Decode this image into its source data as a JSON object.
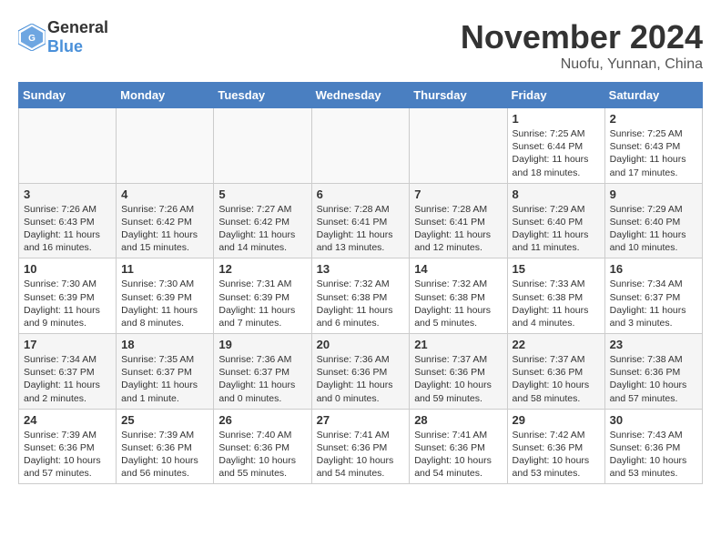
{
  "logo": {
    "text_general": "General",
    "text_blue": "Blue"
  },
  "header": {
    "month_title": "November 2024",
    "subtitle": "Nuofu, Yunnan, China"
  },
  "calendar": {
    "days_of_week": [
      "Sunday",
      "Monday",
      "Tuesday",
      "Wednesday",
      "Thursday",
      "Friday",
      "Saturday"
    ],
    "weeks": [
      [
        {
          "day": "",
          "info": ""
        },
        {
          "day": "",
          "info": ""
        },
        {
          "day": "",
          "info": ""
        },
        {
          "day": "",
          "info": ""
        },
        {
          "day": "",
          "info": ""
        },
        {
          "day": "1",
          "info": "Sunrise: 7:25 AM\nSunset: 6:44 PM\nDaylight: 11 hours and 18 minutes."
        },
        {
          "day": "2",
          "info": "Sunrise: 7:25 AM\nSunset: 6:43 PM\nDaylight: 11 hours and 17 minutes."
        }
      ],
      [
        {
          "day": "3",
          "info": "Sunrise: 7:26 AM\nSunset: 6:43 PM\nDaylight: 11 hours and 16 minutes."
        },
        {
          "day": "4",
          "info": "Sunrise: 7:26 AM\nSunset: 6:42 PM\nDaylight: 11 hours and 15 minutes."
        },
        {
          "day": "5",
          "info": "Sunrise: 7:27 AM\nSunset: 6:42 PM\nDaylight: 11 hours and 14 minutes."
        },
        {
          "day": "6",
          "info": "Sunrise: 7:28 AM\nSunset: 6:41 PM\nDaylight: 11 hours and 13 minutes."
        },
        {
          "day": "7",
          "info": "Sunrise: 7:28 AM\nSunset: 6:41 PM\nDaylight: 11 hours and 12 minutes."
        },
        {
          "day": "8",
          "info": "Sunrise: 7:29 AM\nSunset: 6:40 PM\nDaylight: 11 hours and 11 minutes."
        },
        {
          "day": "9",
          "info": "Sunrise: 7:29 AM\nSunset: 6:40 PM\nDaylight: 11 hours and 10 minutes."
        }
      ],
      [
        {
          "day": "10",
          "info": "Sunrise: 7:30 AM\nSunset: 6:39 PM\nDaylight: 11 hours and 9 minutes."
        },
        {
          "day": "11",
          "info": "Sunrise: 7:30 AM\nSunset: 6:39 PM\nDaylight: 11 hours and 8 minutes."
        },
        {
          "day": "12",
          "info": "Sunrise: 7:31 AM\nSunset: 6:39 PM\nDaylight: 11 hours and 7 minutes."
        },
        {
          "day": "13",
          "info": "Sunrise: 7:32 AM\nSunset: 6:38 PM\nDaylight: 11 hours and 6 minutes."
        },
        {
          "day": "14",
          "info": "Sunrise: 7:32 AM\nSunset: 6:38 PM\nDaylight: 11 hours and 5 minutes."
        },
        {
          "day": "15",
          "info": "Sunrise: 7:33 AM\nSunset: 6:38 PM\nDaylight: 11 hours and 4 minutes."
        },
        {
          "day": "16",
          "info": "Sunrise: 7:34 AM\nSunset: 6:37 PM\nDaylight: 11 hours and 3 minutes."
        }
      ],
      [
        {
          "day": "17",
          "info": "Sunrise: 7:34 AM\nSunset: 6:37 PM\nDaylight: 11 hours and 2 minutes."
        },
        {
          "day": "18",
          "info": "Sunrise: 7:35 AM\nSunset: 6:37 PM\nDaylight: 11 hours and 1 minute."
        },
        {
          "day": "19",
          "info": "Sunrise: 7:36 AM\nSunset: 6:37 PM\nDaylight: 11 hours and 0 minutes."
        },
        {
          "day": "20",
          "info": "Sunrise: 7:36 AM\nSunset: 6:36 PM\nDaylight: 11 hours and 0 minutes."
        },
        {
          "day": "21",
          "info": "Sunrise: 7:37 AM\nSunset: 6:36 PM\nDaylight: 10 hours and 59 minutes."
        },
        {
          "day": "22",
          "info": "Sunrise: 7:37 AM\nSunset: 6:36 PM\nDaylight: 10 hours and 58 minutes."
        },
        {
          "day": "23",
          "info": "Sunrise: 7:38 AM\nSunset: 6:36 PM\nDaylight: 10 hours and 57 minutes."
        }
      ],
      [
        {
          "day": "24",
          "info": "Sunrise: 7:39 AM\nSunset: 6:36 PM\nDaylight: 10 hours and 57 minutes."
        },
        {
          "day": "25",
          "info": "Sunrise: 7:39 AM\nSunset: 6:36 PM\nDaylight: 10 hours and 56 minutes."
        },
        {
          "day": "26",
          "info": "Sunrise: 7:40 AM\nSunset: 6:36 PM\nDaylight: 10 hours and 55 minutes."
        },
        {
          "day": "27",
          "info": "Sunrise: 7:41 AM\nSunset: 6:36 PM\nDaylight: 10 hours and 54 minutes."
        },
        {
          "day": "28",
          "info": "Sunrise: 7:41 AM\nSunset: 6:36 PM\nDaylight: 10 hours and 54 minutes."
        },
        {
          "day": "29",
          "info": "Sunrise: 7:42 AM\nSunset: 6:36 PM\nDaylight: 10 hours and 53 minutes."
        },
        {
          "day": "30",
          "info": "Sunrise: 7:43 AM\nSunset: 6:36 PM\nDaylight: 10 hours and 53 minutes."
        }
      ]
    ]
  }
}
